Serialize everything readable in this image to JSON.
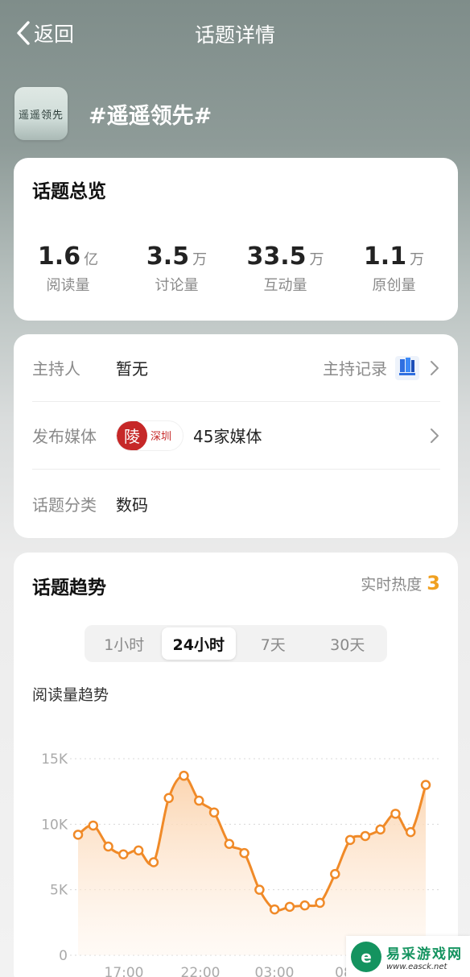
{
  "nav": {
    "back_label": "返回",
    "title": "话题详情"
  },
  "topic": {
    "logo_text": "遥遥领先",
    "name": "#遥遥领先#"
  },
  "overview": {
    "title": "话题总览",
    "stats": [
      {
        "value": "1.6",
        "unit": "亿",
        "label": "阅读量"
      },
      {
        "value": "3.5",
        "unit": "万",
        "label": "讨论量"
      },
      {
        "value": "33.5",
        "unit": "万",
        "label": "互动量"
      },
      {
        "value": "1.1",
        "unit": "万",
        "label": "原创量"
      }
    ]
  },
  "info": {
    "host_label": "主持人",
    "host_value": "暂无",
    "host_record_label": "主持记录",
    "media_label": "发布媒体",
    "media_logo_char": "陵",
    "media_logo_text": "深圳",
    "media_value": "45家媒体",
    "category_label": "话题分类",
    "category_value": "数码"
  },
  "trend": {
    "title": "话题趋势",
    "heat_label": "实时热度",
    "heat_value": "3",
    "tabs": [
      "1小时",
      "24小时",
      "7天",
      "30天"
    ],
    "active_tab": "24小时",
    "subtitle": "阅读量趋势"
  },
  "chart_data": {
    "type": "area",
    "title": "阅读量趋势",
    "y_ticks": [
      "15K",
      "10K",
      "5K",
      "0"
    ],
    "ylim": [
      0,
      15000
    ],
    "x_ticks": [
      "17:00",
      "22:00",
      "03:00",
      "08"
    ],
    "values": [
      9200,
      9900,
      8300,
      7700,
      8000,
      7100,
      12000,
      13700,
      11800,
      10900,
      8500,
      7800,
      5000,
      3500,
      3700,
      3800,
      4000,
      6200,
      8800,
      9100,
      9600,
      10800,
      9400,
      13000
    ],
    "line_color": "#f08a28",
    "fill_color": "#fde3c8",
    "grid": "dotted"
  },
  "watermark": {
    "name": "易采游戏网",
    "url": "www.easck.net"
  }
}
